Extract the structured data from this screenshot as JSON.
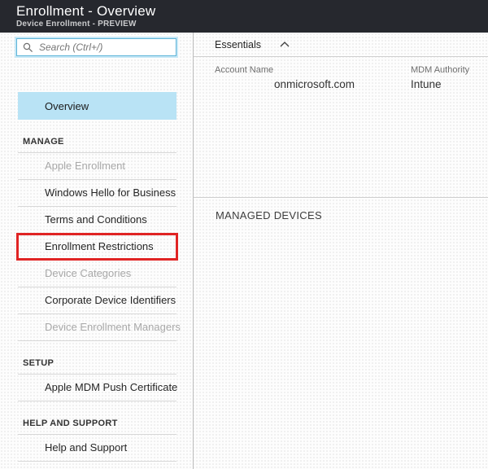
{
  "header": {
    "title": "Enrollment - Overview",
    "subtitle": "Device Enrollment - PREVIEW"
  },
  "sidebar": {
    "search_placeholder": "Search (Ctrl+/)",
    "overview_label": "Overview",
    "sections": [
      {
        "label": "MANAGE",
        "items": [
          {
            "label": "Apple Enrollment",
            "disabled": true,
            "highlighted": false
          },
          {
            "label": "Windows Hello for Business",
            "disabled": false,
            "highlighted": false
          },
          {
            "label": "Terms and Conditions",
            "disabled": false,
            "highlighted": false
          },
          {
            "label": "Enrollment Restrictions",
            "disabled": false,
            "highlighted": true
          },
          {
            "label": "Device Categories",
            "disabled": true,
            "highlighted": false
          },
          {
            "label": "Corporate Device Identifiers",
            "disabled": false,
            "highlighted": false
          },
          {
            "label": "Device Enrollment Managers",
            "disabled": true,
            "highlighted": false
          }
        ]
      },
      {
        "label": "SETUP",
        "items": [
          {
            "label": "Apple MDM Push Certificate",
            "disabled": false,
            "highlighted": false
          }
        ]
      },
      {
        "label": "HELP AND SUPPORT",
        "items": [
          {
            "label": "Help and Support",
            "disabled": false,
            "highlighted": false
          }
        ]
      }
    ]
  },
  "content": {
    "essentials": {
      "title": "Essentials",
      "fields": [
        {
          "label": "Account Name",
          "value": "onmicrosoft.com"
        },
        {
          "label": "MDM Authority",
          "value": "Intune"
        }
      ]
    },
    "managed_devices_title": "MANAGED DEVICES"
  },
  "icons": {
    "search": "search-icon",
    "essentials_collapse": "chevron-up-icon"
  },
  "colors": {
    "header_bg": "#26282e",
    "selected_item_bg": "#b9e3f5",
    "highlight_border": "#e02424",
    "search_border": "#5db4d8",
    "divider": "#d8d8d8"
  }
}
